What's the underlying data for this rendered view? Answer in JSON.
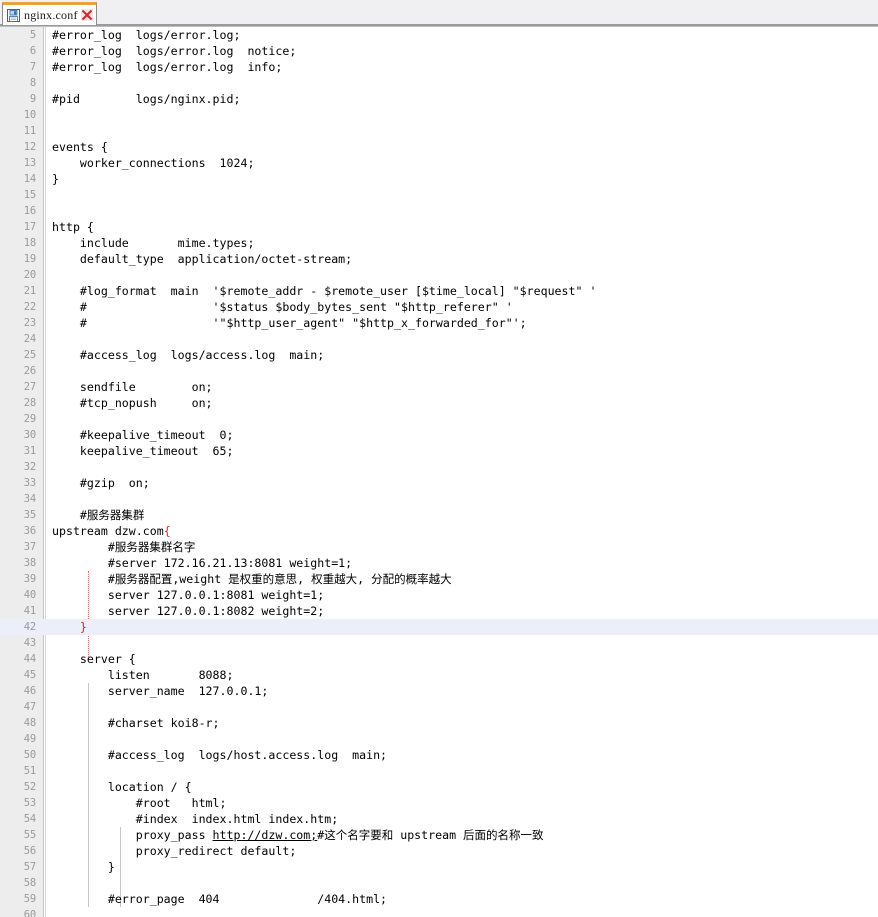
{
  "window": {
    "title": "nginx.conf",
    "accent_tab_border": "#e8a33d",
    "current_line_highlight": "#eceef9",
    "gutter_bg": "#ededed",
    "line_number_color": "#9a9a9a",
    "brace_match_color": "#d8282b"
  },
  "tab": {
    "label": "nginx.conf",
    "save_icon": "floppy-disk-icon",
    "close_icon": "close-x-icon",
    "active": true
  },
  "editor": {
    "first_visible_line": 5,
    "last_visible_line": 60,
    "current_line": 42,
    "language": "nginx-conf",
    "lines": [
      {
        "n": 5,
        "text": "#error_log  logs/error.log;"
      },
      {
        "n": 6,
        "text": "#error_log  logs/error.log  notice;"
      },
      {
        "n": 7,
        "text": "#error_log  logs/error.log  info;"
      },
      {
        "n": 8,
        "text": ""
      },
      {
        "n": 9,
        "text": "#pid        logs/nginx.pid;"
      },
      {
        "n": 10,
        "text": ""
      },
      {
        "n": 11,
        "text": ""
      },
      {
        "n": 12,
        "text": "events {"
      },
      {
        "n": 13,
        "text": "    worker_connections  1024;"
      },
      {
        "n": 14,
        "text": "}"
      },
      {
        "n": 15,
        "text": ""
      },
      {
        "n": 16,
        "text": ""
      },
      {
        "n": 17,
        "text": "http {"
      },
      {
        "n": 18,
        "text": "    include       mime.types;"
      },
      {
        "n": 19,
        "text": "    default_type  application/octet-stream;"
      },
      {
        "n": 20,
        "text": ""
      },
      {
        "n": 21,
        "text": "    #log_format  main  '$remote_addr - $remote_user [$time_local] \"$request\" '"
      },
      {
        "n": 22,
        "text": "    #                  '$status $body_bytes_sent \"$http_referer\" '"
      },
      {
        "n": 23,
        "text": "    #                  '\"$http_user_agent\" \"$http_x_forwarded_for\"';"
      },
      {
        "n": 24,
        "text": ""
      },
      {
        "n": 25,
        "text": "    #access_log  logs/access.log  main;"
      },
      {
        "n": 26,
        "text": ""
      },
      {
        "n": 27,
        "text": "    sendfile        on;"
      },
      {
        "n": 28,
        "text": "    #tcp_nopush     on;"
      },
      {
        "n": 29,
        "text": ""
      },
      {
        "n": 30,
        "text": "    #keepalive_timeout  0;"
      },
      {
        "n": 31,
        "text": "    keepalive_timeout  65;"
      },
      {
        "n": 32,
        "text": ""
      },
      {
        "n": 33,
        "text": "    #gzip  on;"
      },
      {
        "n": 34,
        "text": ""
      },
      {
        "n": 35,
        "text": "    #服务器集群"
      },
      {
        "n": 36,
        "text": "    upstream dzw.com{"
      },
      {
        "n": 37,
        "text": "        #服务器集群名字"
      },
      {
        "n": 38,
        "text": "        #server 172.16.21.13:8081 weight=1;"
      },
      {
        "n": 39,
        "text": "        #服务器配置,weight 是权重的意思, 权重越大, 分配的概率越大"
      },
      {
        "n": 40,
        "text": "        server 127.0.0.1:8081 weight=1;"
      },
      {
        "n": 41,
        "text": "        server 127.0.0.1:8082 weight=2;"
      },
      {
        "n": 42,
        "text": "    }"
      },
      {
        "n": 43,
        "text": ""
      },
      {
        "n": 44,
        "text": "    server {"
      },
      {
        "n": 45,
        "text": "        listen       8088;"
      },
      {
        "n": 46,
        "text": "        server_name  127.0.0.1;"
      },
      {
        "n": 47,
        "text": ""
      },
      {
        "n": 48,
        "text": "        #charset koi8-r;"
      },
      {
        "n": 49,
        "text": ""
      },
      {
        "n": 50,
        "text": "        #access_log  logs/host.access.log  main;"
      },
      {
        "n": 51,
        "text": ""
      },
      {
        "n": 52,
        "text": "        location / {"
      },
      {
        "n": 53,
        "text": "            #root   html;"
      },
      {
        "n": 54,
        "text": "            #index  index.html index.htm;"
      },
      {
        "n": 55,
        "text": "            proxy_pass http://dzw.com;#这个名字要和 upstream 后面的名称一致"
      },
      {
        "n": 56,
        "text": "            proxy_redirect default;"
      },
      {
        "n": 57,
        "text": "        }"
      },
      {
        "n": 58,
        "text": ""
      },
      {
        "n": 59,
        "text": "        #error_page  404              /404.html;"
      },
      {
        "n": 60,
        "text": ""
      }
    ],
    "segments": {
      "line36_code": "upstream dzw.com",
      "line36_brace": "{",
      "line42_indent": "    ",
      "line42_brace": "}",
      "line55_prefix": "            proxy_pass ",
      "line55_url": "http://dzw.com;",
      "line55_suffix": "#这个名字要和 upstream 后面的名称一致"
    }
  }
}
